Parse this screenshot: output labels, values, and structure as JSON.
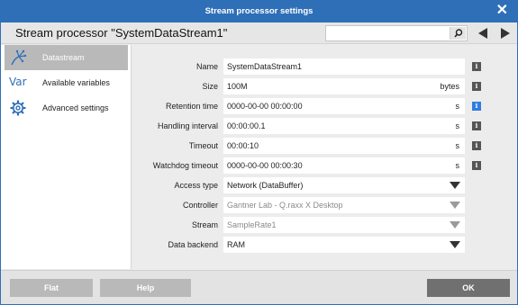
{
  "window": {
    "title": "Stream processor settings",
    "close_glyph": "✕"
  },
  "header": {
    "caption": "Stream processor \"SystemDataStream1\"",
    "search_placeholder": "",
    "search_icon": "search-icon",
    "nav_back_icon": "arrow-left-icon",
    "nav_forward_icon": "arrow-right-icon"
  },
  "sidebar": {
    "items": [
      {
        "label": "Datastream",
        "icon": "datastream-icon",
        "active": true
      },
      {
        "label": "Available variables",
        "icon": "var-icon",
        "icon_text": "Var",
        "active": false
      },
      {
        "label": "Advanced settings",
        "icon": "gear-icon",
        "active": false
      }
    ]
  },
  "form": {
    "rows": [
      {
        "label": "Name",
        "value": "SystemDataStream1",
        "unit": "",
        "info": "i"
      },
      {
        "label": "Size",
        "value": "100M",
        "unit": "bytes",
        "info": "i"
      },
      {
        "label": "Retention time",
        "value": "0000-00-00 00:00:00",
        "unit": "s",
        "info": "i"
      },
      {
        "label": "Handling interval",
        "value": "00:00:00.1",
        "unit": "s",
        "info": "i"
      },
      {
        "label": "Timeout",
        "value": "00:00:10",
        "unit": "s",
        "info": "i"
      },
      {
        "label": "Watchdog timeout",
        "value": "0000-00-00 00:00:30",
        "unit": "s",
        "info": "i"
      },
      {
        "label": "Access type",
        "value": "Network (DataBuffer)"
      },
      {
        "label": "Controller",
        "value": "Gantner Lab - Q.raxx X Desktop"
      },
      {
        "label": "Stream",
        "value": "SampleRate1"
      },
      {
        "label": "Data backend",
        "value": "RAM"
      }
    ]
  },
  "footer": {
    "flat_label": "Flat",
    "help_label": "Help",
    "ok_label": "OK"
  },
  "colors": {
    "accent": "#2f6fb8",
    "info_active": "#2f7de0",
    "sidebar_active": "#b9b9b9",
    "ok_button": "#707070"
  }
}
